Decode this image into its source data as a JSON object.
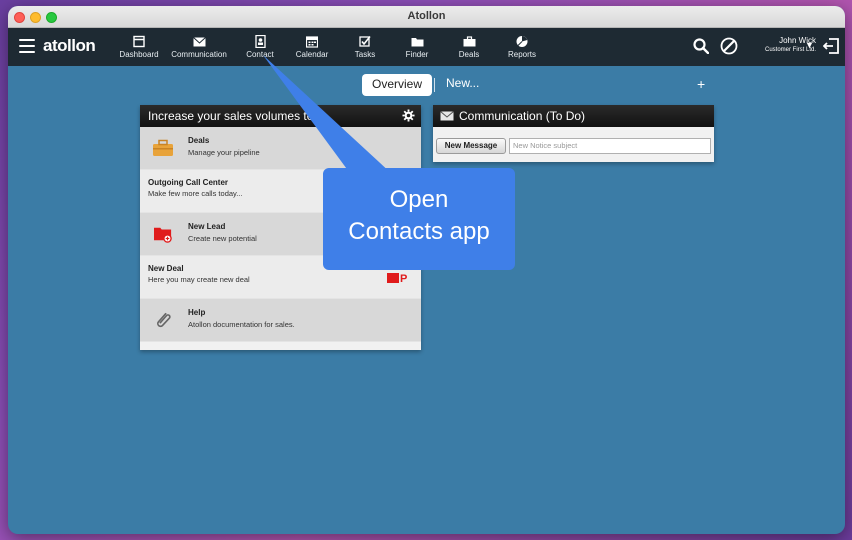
{
  "window": {
    "title": "Atollon"
  },
  "brand": {
    "logo_text": "atollon"
  },
  "nav": {
    "items": [
      {
        "label": "Dashboard",
        "icon": "dashboard-icon"
      },
      {
        "label": "Communication",
        "icon": "envelope-icon"
      },
      {
        "label": "Contact",
        "icon": "contact-book-icon"
      },
      {
        "label": "Calendar",
        "icon": "calendar-icon"
      },
      {
        "label": "Tasks",
        "icon": "checkbox-icon"
      },
      {
        "label": "Finder",
        "icon": "folder-icon"
      },
      {
        "label": "Deals",
        "icon": "briefcase-icon"
      },
      {
        "label": "Reports",
        "icon": "pie-chart-icon"
      }
    ]
  },
  "user": {
    "name": "John Wick",
    "company": "Customer First Ltd."
  },
  "tabs": {
    "overview": "Overview",
    "new": "New...",
    "add": "+"
  },
  "sales_panel": {
    "title": "Increase your sales volumes to",
    "items": [
      {
        "title": "Deals",
        "subtitle": "Manage your pipeline"
      },
      {
        "title": "Outgoing Call Center",
        "subtitle": "Make few more calls today..."
      },
      {
        "title": "New Lead",
        "subtitle": "Create new potential"
      },
      {
        "title": "New Deal",
        "subtitle": "Here you may create new deal"
      },
      {
        "title": "Help",
        "subtitle": "Atollon documentation for sales."
      }
    ]
  },
  "comm_panel": {
    "title": "Communication (To Do)",
    "new_message_label": "New Message",
    "notice_placeholder": "New Notice subject"
  },
  "callout": {
    "line1": "Open",
    "line2": "Contacts app"
  },
  "colors": {
    "workspace": "#3b7ca6",
    "toolbar": "#1e2a33",
    "callout": "#3f7fe8",
    "lead_red": "#e01b1b",
    "deals_orange": "#e8a33a"
  }
}
